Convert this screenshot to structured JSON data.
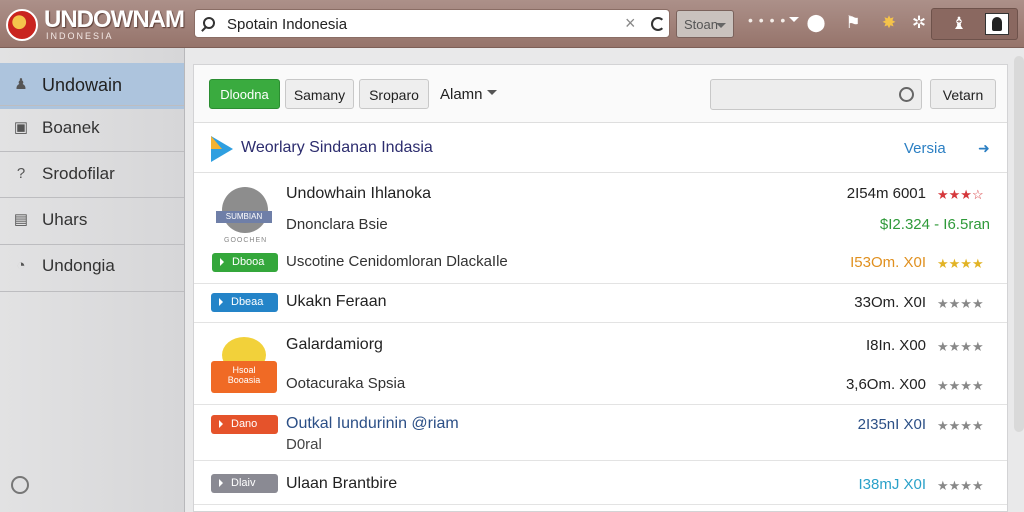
{
  "logo": {
    "title": "UNDOWNAM",
    "subtitle": "INDONESIA",
    "badge_text": ""
  },
  "search": {
    "value": "Spotain Indonesia",
    "placeholder": ""
  },
  "toolbar": {
    "store_label": "Stoan",
    "dots_label": "• • • •"
  },
  "sidebar": {
    "items": [
      {
        "label": "Undowain",
        "icon": "user-icon",
        "active": true
      },
      {
        "label": "Boanek",
        "icon": "book-icon",
        "active": false
      },
      {
        "label": "Srodofilar",
        "icon": "question-icon",
        "active": false
      },
      {
        "label": "Uhars",
        "icon": "briefcase-icon",
        "active": false
      },
      {
        "label": "Undongia",
        "icon": "gauge-icon",
        "active": false
      }
    ]
  },
  "filters": {
    "primary": "Dloodna",
    "btn2": "Samany",
    "btn3": "Sroparo",
    "dropdown": "Alamn",
    "search_button": "Vetarn"
  },
  "section": {
    "title": "Weorlary Sindanan Indasia",
    "link": "Versia",
    "link_arrow": "➜"
  },
  "rows": [
    {
      "title": "Undowhain Ihlanoka",
      "sub": "Dnonclara Bsie",
      "sub2": "Uscotine Cenidomloran DlackaIle",
      "pill": "Dbooa",
      "pill_color": "#34a73b",
      "meta1": "2I54m 6001",
      "meta2": "$I2.324 - I6.5ran",
      "meta3": "I53Om. X0I",
      "stars1": "★★★☆",
      "stars3": "★★★★",
      "icon_label": "SUMBIAN",
      "icon_sub": "GOOCHEN"
    },
    {
      "title": "Ukakn Feraan",
      "pill": "Dbeaa",
      "pill_color": "#2484c8",
      "meta": "33Om. X0I",
      "stars": "★★★★"
    },
    {
      "title": "Galardamiorg",
      "sub": "Ootacuraka Spsia",
      "meta1": "I8In. X00",
      "meta2": "3,6Om. X00",
      "stars1": "★★★★",
      "stars2": "★★★★",
      "icon_label": "Hsoal",
      "icon_sub": "Booasia"
    },
    {
      "title": "Outkal Iundurinin @riam",
      "sub": "D0ral",
      "pill": "Dano",
      "pill_color": "#e5532b",
      "meta": "2I35nI X0I",
      "stars": "★★★★"
    },
    {
      "title": "Ulaan Brantbire",
      "pill": "Dlaiv",
      "pill_color": "#8a8a93",
      "meta": "I38mJ X0I",
      "stars": "★★★★"
    }
  ],
  "colors": {
    "accent_green": "#3aab3f",
    "link_blue": "#2b7fc3",
    "topbar": "#a2847c",
    "sidebar_active": "#adc4dd"
  }
}
